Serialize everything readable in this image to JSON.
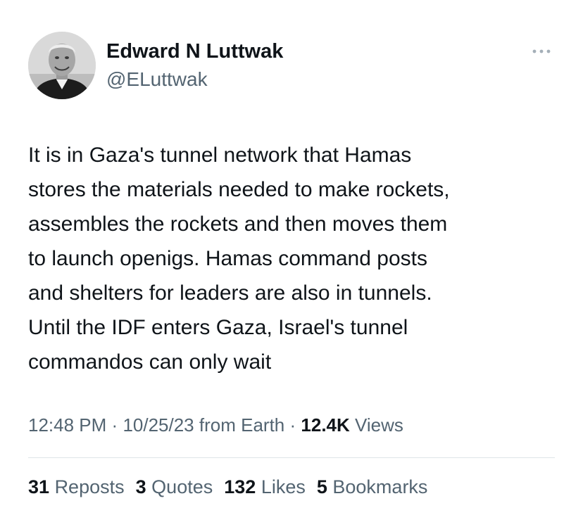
{
  "author": {
    "display_name": "Edward N Luttwak",
    "handle": "@ELuttwak"
  },
  "more_icon": "more-horizontal-icon",
  "tweet": {
    "text": "It is in Gaza's tunnel network that Hamas\nstores the materials needed to make rockets,\nassembles the rockets and then moves them\nto launch openigs. Hamas command posts\nand shelters for leaders are also in tunnels.\nUntil the IDF enters Gaza, Israel's tunnel\ncommandos can only wait"
  },
  "meta": {
    "time": "12:48 PM",
    "separator": "·",
    "date": "10/25/23",
    "source": "from Earth",
    "views_count": "12.4K",
    "views_label": "Views"
  },
  "stats": {
    "reposts": {
      "count": "31",
      "label": "Reposts"
    },
    "quotes": {
      "count": "3",
      "label": "Quotes"
    },
    "likes": {
      "count": "132",
      "label": "Likes"
    },
    "bookmarks": {
      "count": "5",
      "label": "Bookmarks"
    }
  },
  "colors": {
    "primary_text": "#0f1419",
    "secondary_text": "#536471",
    "divider": "#dfe4e8"
  }
}
